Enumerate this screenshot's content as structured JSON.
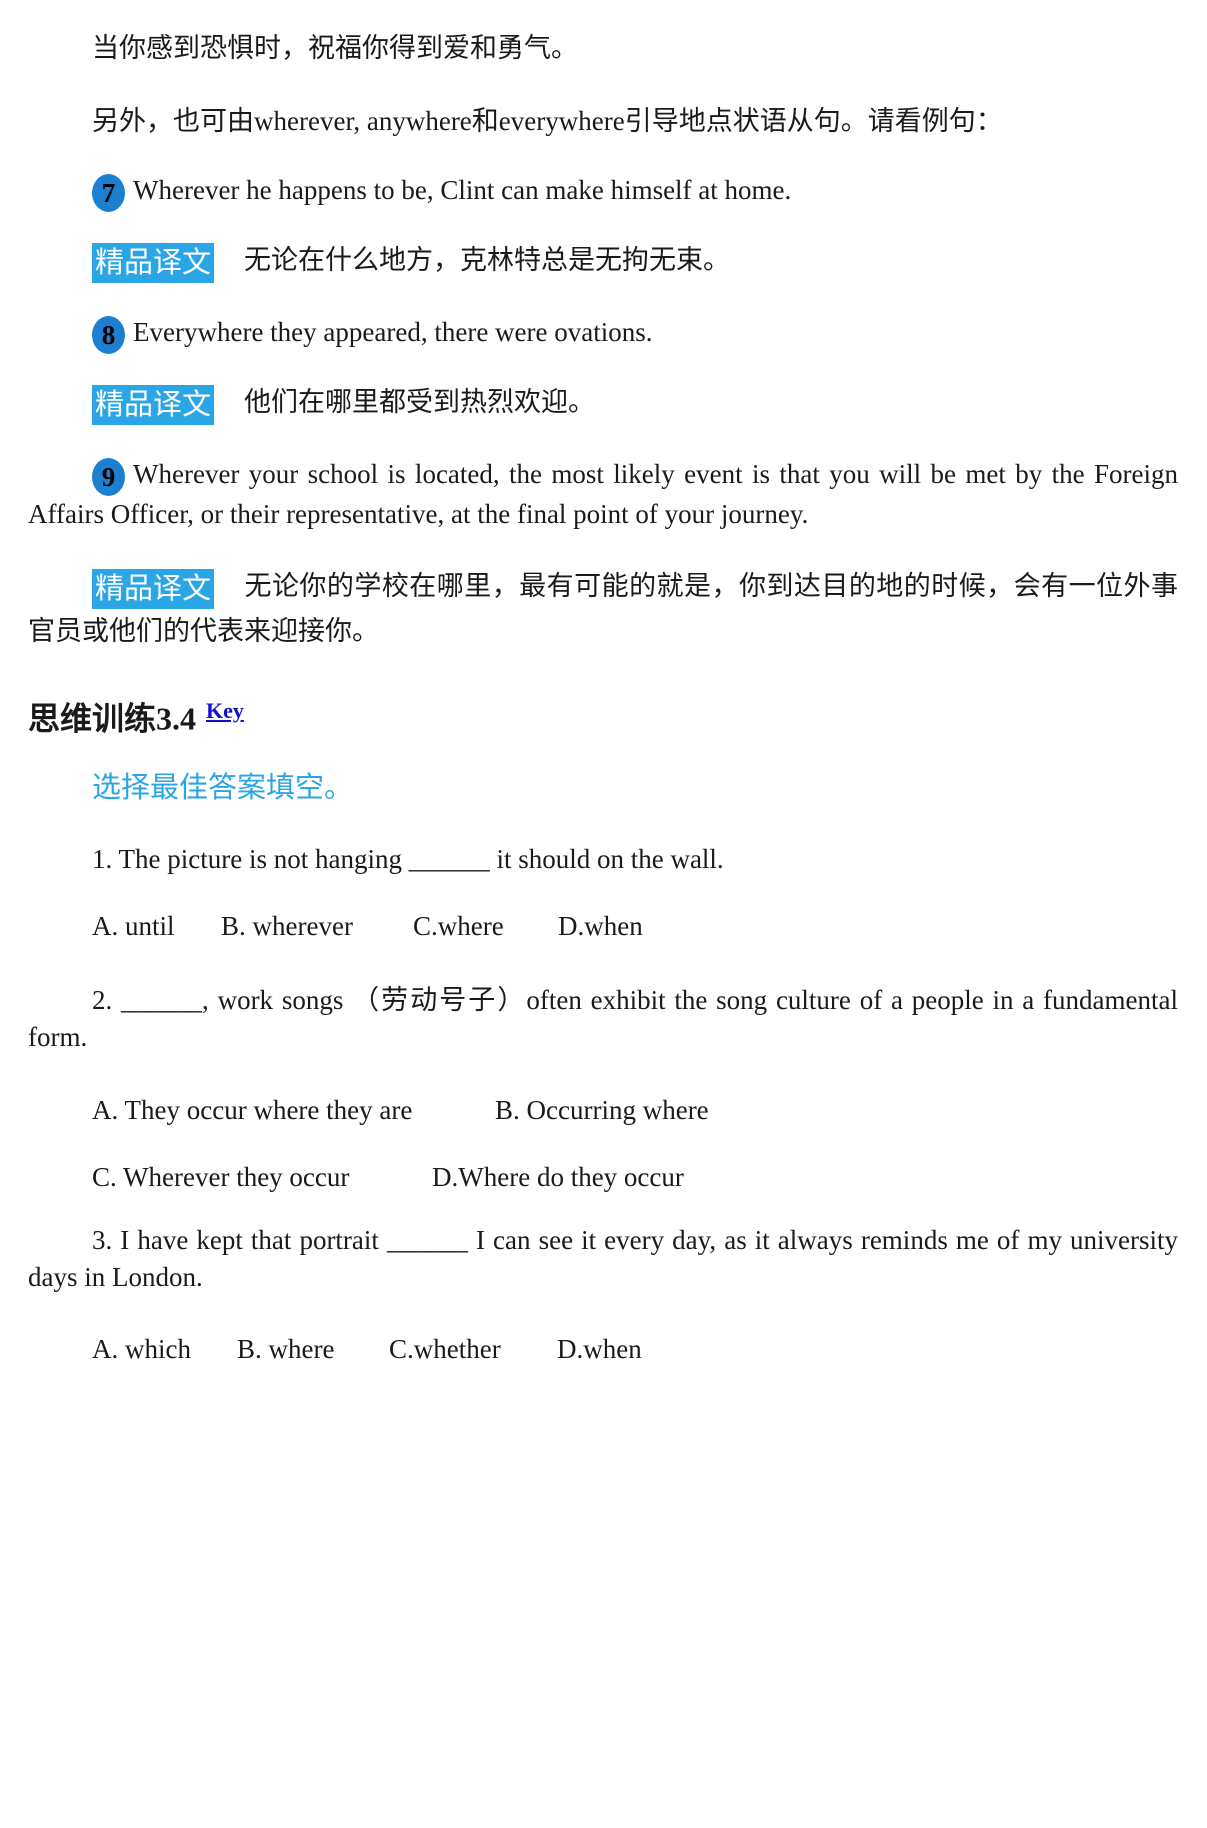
{
  "intro_line1": "当你感到恐惧时，祝福你得到爱和勇气。",
  "intro_line2": "另外，也可由wherever, anywhere和everywhere引导地点状语从句。请看例句：",
  "examples": [
    {
      "number": "7",
      "sentence": "Wherever he happens to be, Clint can make himself at home.",
      "tag": "精品译文",
      "translation": "无论在什么地方，克林特总是无拘无束。"
    },
    {
      "number": "8",
      "sentence": "Everywhere they appeared, there were ovations.",
      "tag": "精品译文",
      "translation": "他们在哪里都受到热烈欢迎。"
    },
    {
      "number": "9",
      "sentence": "Wherever your school is located, the most likely event is that you will be met by the Foreign Affairs Officer, or their representative, at the final point of your journey.",
      "tag": "精品译文",
      "translation": "无论你的学校在哪里，最有可能的就是，你到达目的地的时候，会有一位外事官员或他们的代表来迎接你。"
    }
  ],
  "section_title": "思维训练3.4",
  "key_link": "Key",
  "instruction": "选择最佳答案填空。",
  "questions": [
    {
      "stem": "1. The picture is not hanging ______ it should on the wall.",
      "options": [
        "A. until",
        "B. wherever",
        "C.where",
        "D.when"
      ]
    },
    {
      "stem": "2. ______, work songs （劳动号子）often exhibit the song culture of a people in a fundamental form.",
      "options": [
        "A. They occur where they are",
        "B. Occurring where",
        "C. Wherever they occur",
        "D.Where do they occur"
      ]
    },
    {
      "stem": "3. I have kept that portrait ______ I can see it every day, as it always reminds me of my university days in London.",
      "options": [
        "A. which",
        "B. where",
        "C.whether",
        "D.when"
      ]
    }
  ]
}
